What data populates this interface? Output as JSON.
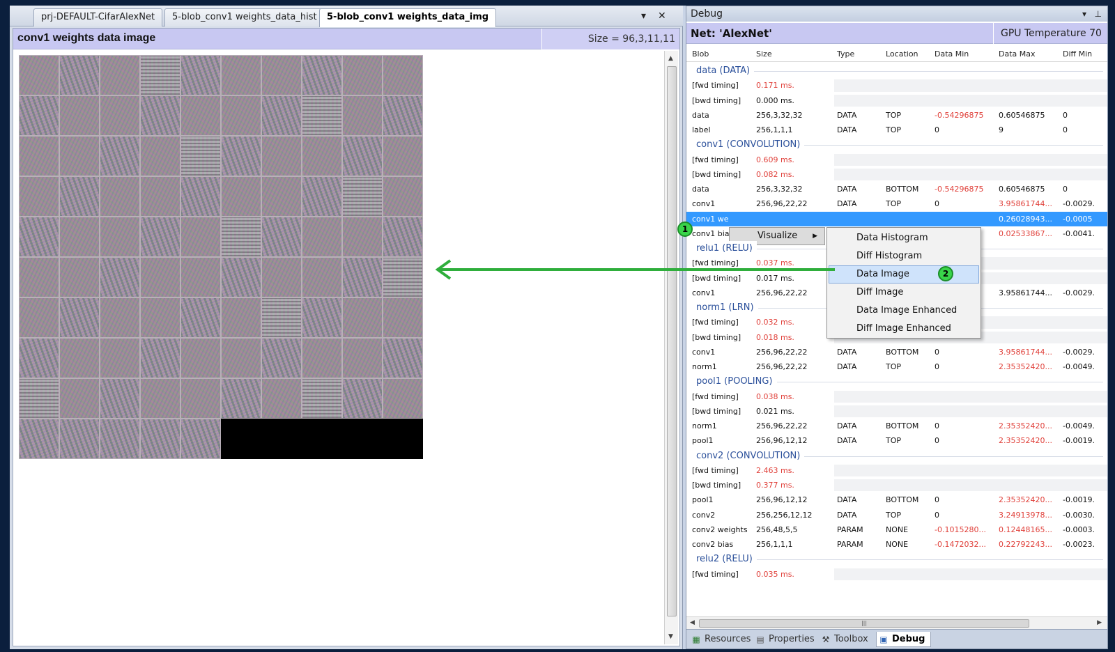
{
  "tabs": [
    {
      "label": "prj-DEFAULT-CifarAlexNet"
    },
    {
      "label": "5-blob_conv1 weights_data_hist"
    },
    {
      "label": "5-blob_conv1 weights_data_img"
    }
  ],
  "tab_controls": {
    "dropdown": "▾",
    "close": "✕"
  },
  "doc": {
    "title": "conv1 weights data image",
    "size": "Size = 96,3,11,11"
  },
  "debug": {
    "title": "Debug",
    "net": "Net: 'AlexNet'",
    "gpu": "GPU Temperature 70",
    "columns": [
      "Blob",
      "Size",
      "Type",
      "Location",
      "Data Min",
      "Data Max",
      "Diff Min"
    ],
    "groups": [
      {
        "label": "data (DATA)",
        "rows": [
          {
            "kind": "timing",
            "blob": "[fwd timing]",
            "size": "0.171 ms.",
            "red": true
          },
          {
            "kind": "timing",
            "blob": "[bwd timing]",
            "size": "0.000 ms.",
            "red": false
          },
          {
            "kind": "blob",
            "blob": "data",
            "size": "256,3,32,32",
            "type": "DATA",
            "loc": "TOP",
            "min": "-0.54296875",
            "max": "0.60546875",
            "diff": "0",
            "min_red": true,
            "max_red": false
          },
          {
            "kind": "blob",
            "blob": "label",
            "size": "256,1,1,1",
            "type": "DATA",
            "loc": "TOP",
            "min": "0",
            "max": "9",
            "diff": "0",
            "min_red": false,
            "max_red": false
          }
        ]
      },
      {
        "label": "conv1 (CONVOLUTION)",
        "rows": [
          {
            "kind": "timing",
            "blob": "[fwd timing]",
            "size": "0.609 ms.",
            "red": true
          },
          {
            "kind": "timing",
            "blob": "[bwd timing]",
            "size": "0.082 ms.",
            "red": true
          },
          {
            "kind": "blob",
            "blob": "data",
            "size": "256,3,32,32",
            "type": "DATA",
            "loc": "BOTTOM",
            "min": "-0.54296875",
            "max": "0.60546875",
            "diff": "0",
            "min_red": true,
            "max_red": false
          },
          {
            "kind": "blob",
            "blob": "conv1",
            "size": "256,96,22,22",
            "type": "DATA",
            "loc": "TOP",
            "min": "0",
            "max": "3.95861744...",
            "diff": "-0.0029.",
            "min_red": false,
            "max_red": true
          },
          {
            "kind": "blob",
            "blob": "conv1 we",
            "size": "",
            "type": "",
            "loc": "",
            "min": "",
            "max": "0.26028943...",
            "diff": "-0.0005",
            "selected": true
          },
          {
            "kind": "blob",
            "blob": "conv1 bia",
            "size": "",
            "type": "",
            "loc": "",
            "min": "",
            "max": "0.02533867...",
            "diff": "-0.0041.",
            "min_red": false,
            "max_red": true
          }
        ]
      },
      {
        "label": "relu1 (RELU)",
        "rows": [
          {
            "kind": "timing",
            "blob": "[fwd timing]",
            "size": "0.037 ms.",
            "red": true
          },
          {
            "kind": "timing",
            "blob": "[bwd timing]",
            "size": "0.017 ms.",
            "red": false
          },
          {
            "kind": "blob",
            "blob": "conv1",
            "size": "256,96,22,22",
            "type": "",
            "loc": "",
            "min": "",
            "max": "3.95861744...",
            "diff": "-0.0029.",
            "min_red": false,
            "max_red": false
          }
        ]
      },
      {
        "label": "norm1 (LRN)",
        "rows": [
          {
            "kind": "timing",
            "blob": "[fwd timing]",
            "size": "0.032 ms.",
            "red": true
          },
          {
            "kind": "timing",
            "blob": "[bwd timing]",
            "size": "0.018 ms.",
            "red": true
          },
          {
            "kind": "blob",
            "blob": "conv1",
            "size": "256,96,22,22",
            "type": "DATA",
            "loc": "BOTTOM",
            "min": "0",
            "max": "3.95861744...",
            "diff": "-0.0029.",
            "min_red": false,
            "max_red": true
          },
          {
            "kind": "blob",
            "blob": "norm1",
            "size": "256,96,22,22",
            "type": "DATA",
            "loc": "TOP",
            "min": "0",
            "max": "2.35352420...",
            "diff": "-0.0049.",
            "min_red": false,
            "max_red": true
          }
        ]
      },
      {
        "label": "pool1 (POOLING)",
        "rows": [
          {
            "kind": "timing",
            "blob": "[fwd timing]",
            "size": "0.038 ms.",
            "red": true
          },
          {
            "kind": "timing",
            "blob": "[bwd timing]",
            "size": "0.021 ms.",
            "red": false
          },
          {
            "kind": "blob",
            "blob": "norm1",
            "size": "256,96,22,22",
            "type": "DATA",
            "loc": "BOTTOM",
            "min": "0",
            "max": "2.35352420...",
            "diff": "-0.0049.",
            "min_red": false,
            "max_red": true
          },
          {
            "kind": "blob",
            "blob": "pool1",
            "size": "256,96,12,12",
            "type": "DATA",
            "loc": "TOP",
            "min": "0",
            "max": "2.35352420...",
            "diff": "-0.0019.",
            "min_red": false,
            "max_red": true
          }
        ]
      },
      {
        "label": "conv2 (CONVOLUTION)",
        "rows": [
          {
            "kind": "timing",
            "blob": "[fwd timing]",
            "size": "2.463 ms.",
            "red": true
          },
          {
            "kind": "timing",
            "blob": "[bwd timing]",
            "size": "0.377 ms.",
            "red": true
          },
          {
            "kind": "blob",
            "blob": "pool1",
            "size": "256,96,12,12",
            "type": "DATA",
            "loc": "BOTTOM",
            "min": "0",
            "max": "2.35352420...",
            "diff": "-0.0019.",
            "min_red": false,
            "max_red": true
          },
          {
            "kind": "blob",
            "blob": "conv2",
            "size": "256,256,12,12",
            "type": "DATA",
            "loc": "TOP",
            "min": "0",
            "max": "3.24913978...",
            "diff": "-0.0030.",
            "min_red": false,
            "max_red": true
          },
          {
            "kind": "blob",
            "blob": "conv2 weights",
            "size": "256,48,5,5",
            "type": "PARAM",
            "loc": "NONE",
            "min": "-0.1015280...",
            "max": "0.12448165...",
            "diff": "-0.0003.",
            "min_red": true,
            "max_red": true
          },
          {
            "kind": "blob",
            "blob": "conv2 bias",
            "size": "256,1,1,1",
            "type": "PARAM",
            "loc": "NONE",
            "min": "-0.1472032...",
            "max": "0.22792243...",
            "diff": "-0.0023.",
            "min_red": true,
            "max_red": true
          }
        ]
      },
      {
        "label": "relu2 (RELU)",
        "rows": [
          {
            "kind": "timing",
            "blob": "[fwd timing]",
            "size": "0.035 ms.",
            "red": true
          }
        ]
      }
    ]
  },
  "bottom_tabs": [
    {
      "label": "Resources",
      "icon": "resources-icon"
    },
    {
      "label": "Properties",
      "icon": "properties-icon"
    },
    {
      "label": "Toolbox",
      "icon": "toolbox-icon"
    },
    {
      "label": "Debug",
      "icon": "debug-icon"
    }
  ],
  "menu": {
    "visualize": "Visualize",
    "submenu": [
      "Data Histogram",
      "Diff Histogram",
      "Data Image",
      "Diff Image",
      "Data Image Enhanced",
      "Diff Image Enhanced"
    ],
    "hover_index": 2
  },
  "callouts": [
    "1",
    "2"
  ],
  "colors": {
    "accent": "#3399ff",
    "header": "#c8c8f2",
    "arrow": "#2fae3c",
    "red_value": "#e0403a"
  }
}
